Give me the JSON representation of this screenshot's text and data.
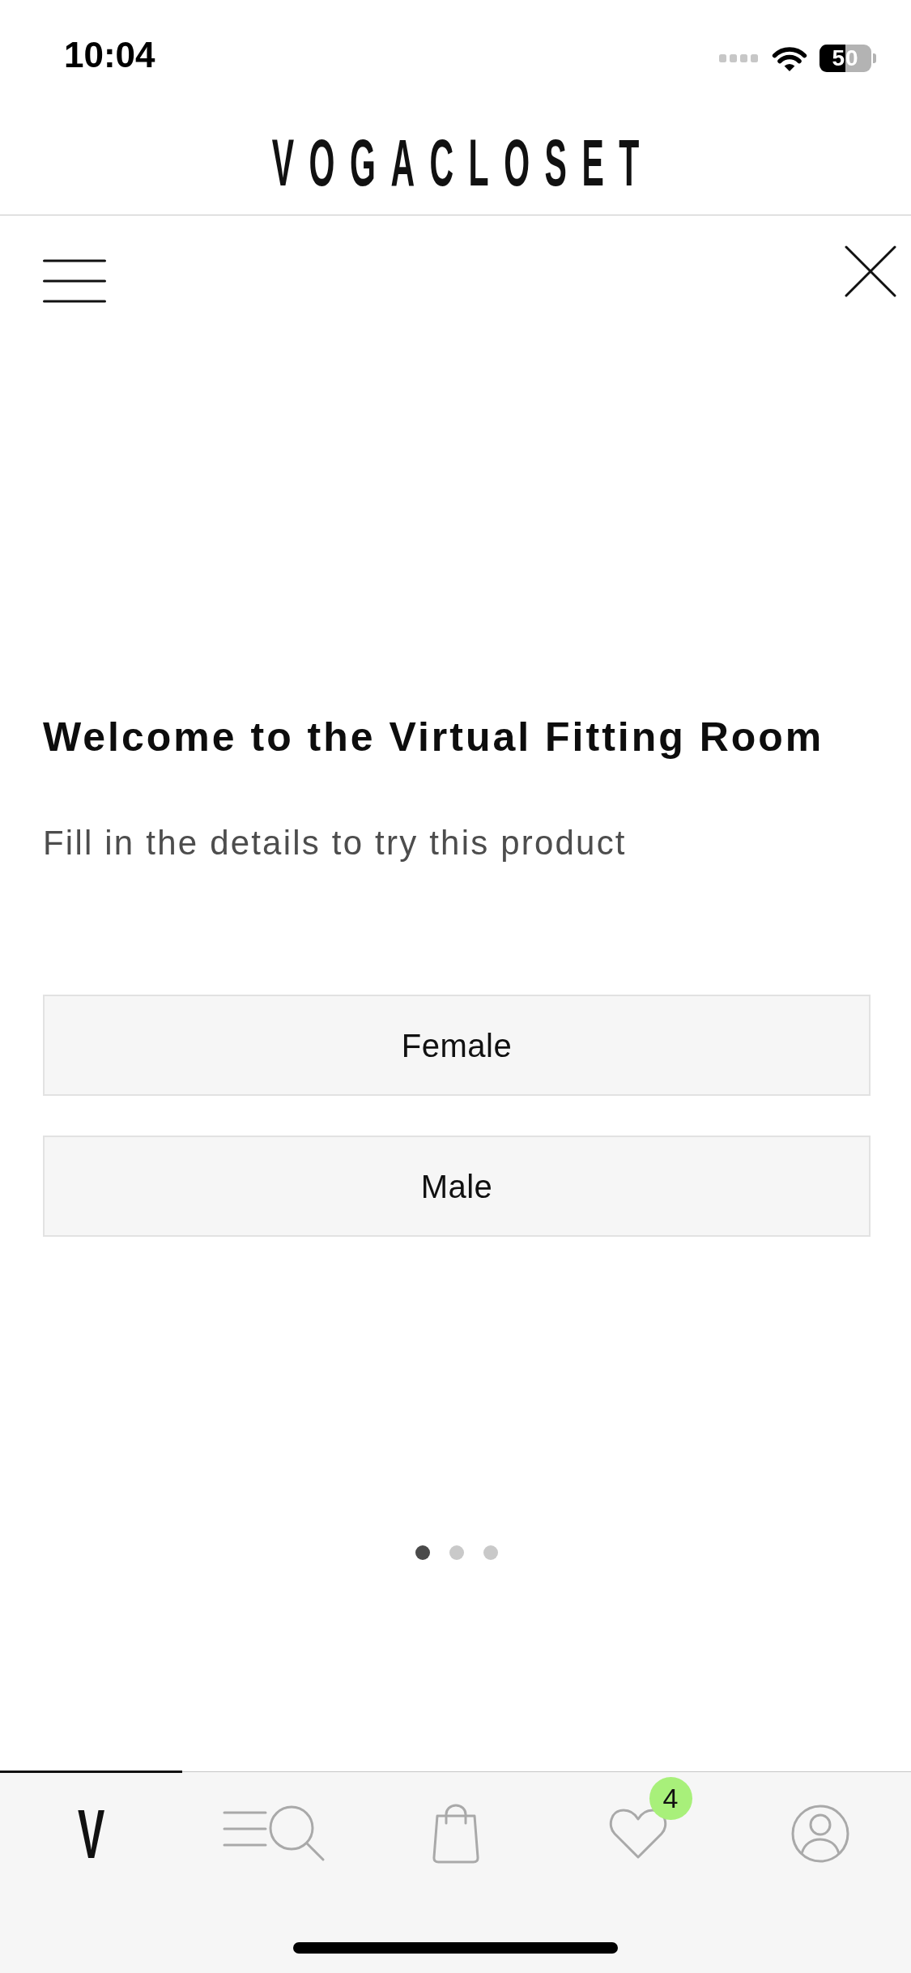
{
  "status_bar": {
    "time": "10:04",
    "battery": "50"
  },
  "header": {
    "logo": "VOGACLOSET"
  },
  "welcome": {
    "title": "Welcome to the Virtual Fitting Room",
    "subtitle": "Fill in the details to try this product",
    "options": [
      "Female",
      "Male"
    ],
    "pager": [
      {
        "selected": true
      },
      {
        "selected": false
      },
      {
        "selected": false
      }
    ]
  },
  "tab_bar": [
    {
      "kind": "logo",
      "label": "V",
      "selected": true
    },
    {
      "kind": "search",
      "selected": false
    },
    {
      "kind": "bag",
      "selected": false
    },
    {
      "kind": "wishlist",
      "selected": false,
      "badge": "4"
    },
    {
      "kind": "account",
      "selected": false
    }
  ]
}
